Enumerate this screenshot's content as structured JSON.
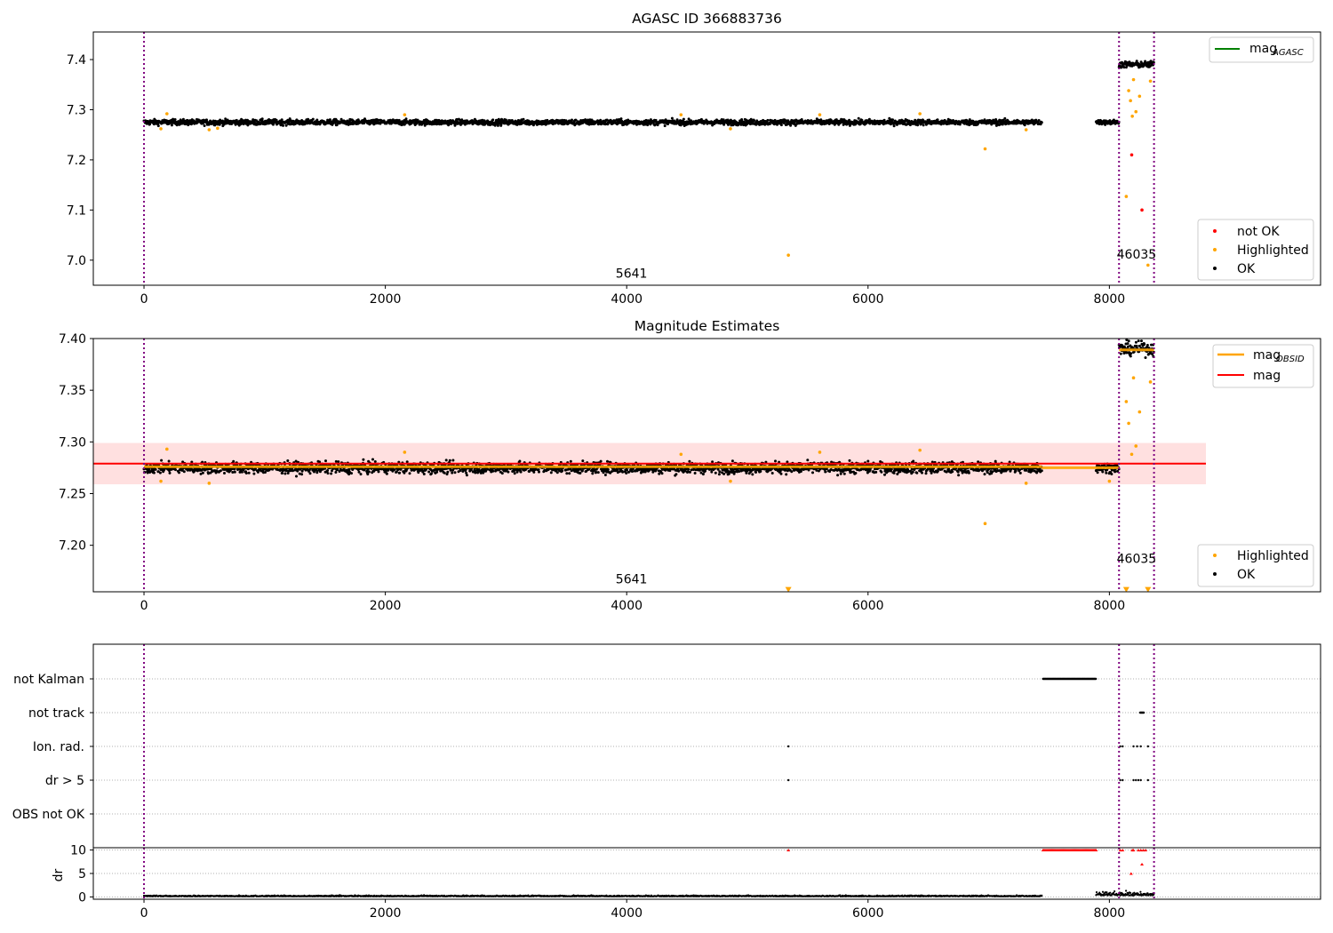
{
  "chart_data": [
    {
      "type": "scatter",
      "title": "AGASC ID 366883736",
      "xlabel": "",
      "ylabel": "",
      "xlim": [
        -420,
        9750
      ],
      "ylim": [
        6.95,
        7.455
      ],
      "xticks": [
        0,
        2000,
        4000,
        6000,
        8000
      ],
      "yticks": [
        7.0,
        7.1,
        7.2,
        7.3,
        7.4
      ],
      "ytick_labels": [
        "7.0",
        "7.1",
        "7.2",
        "7.3",
        "7.4"
      ],
      "obs_boundaries": [
        0,
        8080,
        8370
      ],
      "obsid_labels": [
        {
          "text": "5641",
          "x": 4040,
          "y": 6.965
        },
        {
          "text": "46035",
          "x": 8225,
          "y": 7.003
        }
      ],
      "segments": [
        {
          "name": "OK",
          "x_start": 0,
          "x_end": 7440,
          "level": 7.275,
          "spread": 0.012
        },
        {
          "name": "OK",
          "x_start": 7890,
          "x_end": 8080,
          "level": 7.275,
          "spread": 0.01
        },
        {
          "name": "OK",
          "x_start": 8080,
          "x_end": 8370,
          "level": 7.39,
          "spread": 0.014
        }
      ],
      "series": [
        {
          "name": "not OK",
          "color": "#ff0000",
          "points": [
            [
              8185,
              7.21
            ],
            [
              8270,
              7.1
            ]
          ]
        },
        {
          "name": "Highlighted",
          "color": "#ffa500",
          "points": [
            [
              5340,
              7.01
            ],
            [
              6970,
              7.222
            ],
            [
              8140,
              7.127
            ],
            [
              8160,
              7.338
            ],
            [
              8175,
              7.318
            ],
            [
              8190,
              7.287
            ],
            [
              8200,
              7.36
            ],
            [
              8220,
              7.296
            ],
            [
              8250,
              7.327
            ],
            [
              8320,
              6.99
            ],
            [
              8340,
              7.357
            ],
            [
              190,
              7.292
            ],
            [
              140,
              7.262
            ],
            [
              540,
              7.26
            ],
            [
              610,
              7.263
            ],
            [
              2160,
              7.29
            ],
            [
              4450,
              7.29
            ],
            [
              4860,
              7.262
            ],
            [
              5600,
              7.29
            ],
            [
              6430,
              7.292
            ],
            [
              7310,
              7.26
            ]
          ]
        }
      ],
      "mag_agasc": null,
      "legend_top": [
        {
          "label": "mag",
          "sub": "AGASC",
          "color": "#008000"
        }
      ],
      "legend_bottom": [
        {
          "label": "not OK",
          "color": "#ff0000"
        },
        {
          "label": "Highlighted",
          "color": "#ffa500"
        },
        {
          "label": "OK",
          "color": "#000000"
        }
      ]
    },
    {
      "type": "scatter",
      "title": "Magnitude Estimates",
      "xlabel": "",
      "ylabel": "",
      "xlim": [
        -420,
        9750
      ],
      "ylim": [
        7.155,
        7.4
      ],
      "xticks": [
        0,
        2000,
        4000,
        6000,
        8000
      ],
      "yticks": [
        7.2,
        7.25,
        7.3,
        7.35,
        7.4
      ],
      "ytick_labels": [
        "7.20",
        "7.25",
        "7.30",
        "7.35",
        "7.40"
      ],
      "obs_boundaries": [
        0,
        8080,
        8370
      ],
      "obsid_labels": [
        {
          "text": "5641",
          "x": 4040,
          "y": 7.163
        },
        {
          "text": "46035",
          "x": 8225,
          "y": 7.183
        }
      ],
      "mag": 7.279,
      "mag_band": [
        7.259,
        7.299
      ],
      "mag_band_x": [
        -420,
        8800
      ],
      "mag_obsid": [
        {
          "x_start": 0,
          "x_end": 7440,
          "value": 7.276
        },
        {
          "x_start": 7440,
          "x_end": 8080,
          "value": 7.275
        },
        {
          "x_start": 8080,
          "x_end": 8370,
          "value": 7.389
        }
      ],
      "segments": [
        {
          "name": "OK",
          "x_start": 0,
          "x_end": 7440,
          "level": 7.275,
          "spread": 0.012
        },
        {
          "name": "OK",
          "x_start": 7890,
          "x_end": 8080,
          "level": 7.275,
          "spread": 0.01
        },
        {
          "name": "OK",
          "x_start": 8080,
          "x_end": 8370,
          "level": 7.39,
          "spread": 0.014
        }
      ],
      "series": [
        {
          "name": "Highlighted",
          "color": "#ffa500",
          "points": [
            [
              6970,
              7.221
            ],
            [
              8140,
              7.339
            ],
            [
              8160,
              7.318
            ],
            [
              8185,
              7.288
            ],
            [
              8200,
              7.362
            ],
            [
              8220,
              7.296
            ],
            [
              8250,
              7.329
            ],
            [
              8340,
              7.358
            ],
            [
              190,
              7.293
            ],
            [
              140,
              7.262
            ],
            [
              540,
              7.26
            ],
            [
              2160,
              7.29
            ],
            [
              4450,
              7.288
            ],
            [
              4860,
              7.262
            ],
            [
              5600,
              7.29
            ],
            [
              6430,
              7.292
            ],
            [
              7310,
              7.26
            ],
            [
              8000,
              7.262
            ]
          ]
        },
        {
          "name": "Highlighted (clipped)",
          "color": "#ffa500",
          "points": [
            [
              5340,
              7.157
            ],
            [
              8140,
              7.157
            ],
            [
              8320,
              7.157
            ]
          ]
        }
      ],
      "legend_top": [
        {
          "label": "mag",
          "sub": "OBSID",
          "color": "#ffa500"
        },
        {
          "label": "mag",
          "sub": "",
          "color": "#ff0000"
        }
      ],
      "legend_bottom": [
        {
          "label": "Highlighted",
          "color": "#ffa500"
        },
        {
          "label": "OK",
          "color": "#000000"
        }
      ]
    },
    {
      "type": "scatter",
      "title": "",
      "xlabel": "",
      "xlim": [
        -420,
        9750
      ],
      "category_labels": [
        "not Kalman",
        "not track",
        "Ion. rad.",
        "dr > 5",
        "OBS not OK"
      ],
      "obs_boundaries": [
        0,
        8080,
        8370
      ],
      "flag_ranges": [
        {
          "category": "not Kalman",
          "x_start": 7450,
          "x_end": 7890
        },
        {
          "category": "not track",
          "x_start": 8255,
          "x_end": 8290
        }
      ],
      "flag_points": [
        {
          "category": "Ion. rad.",
          "x": [
            5340,
            8090,
            8110,
            8200,
            8230,
            8260,
            8320
          ]
        },
        {
          "category": "dr > 5",
          "x": [
            5340,
            8090,
            8110,
            8200,
            8220,
            8240,
            8260,
            8320
          ]
        }
      ]
    },
    {
      "type": "scatter",
      "title": "",
      "xlabel": "",
      "ylabel": "dr",
      "xlim": [
        -420,
        9750
      ],
      "ylim": [
        -0.5,
        10.5
      ],
      "yticks": [
        0,
        5,
        10
      ],
      "ytick_labels": [
        "0",
        "5",
        "10"
      ],
      "obs_boundaries": [
        0,
        8080,
        8370
      ],
      "dr_red_range": {
        "x_start": 7450,
        "x_end": 7890,
        "value": 10
      },
      "dr_red_points": [
        [
          5340,
          10
        ],
        [
          8090,
          10
        ],
        [
          8110,
          10
        ],
        [
          8190,
          10
        ],
        [
          8200,
          10
        ],
        [
          8240,
          10
        ],
        [
          8260,
          10
        ],
        [
          8280,
          10
        ],
        [
          8300,
          10
        ],
        [
          8270,
          7
        ],
        [
          8180,
          5
        ]
      ],
      "dr_black_segments": [
        {
          "x_start": 0,
          "x_end": 7440,
          "level": 0.1,
          "spread": 0.2
        },
        {
          "x_start": 7890,
          "x_end": 8370,
          "level": 0.3,
          "spread": 0.7
        }
      ]
    }
  ]
}
